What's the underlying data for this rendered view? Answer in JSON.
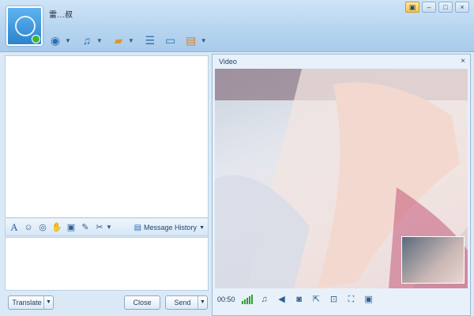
{
  "header": {
    "contact_name": "雷…叔"
  },
  "toolbar": {
    "icons": [
      "camera-icon",
      "microphone-icon",
      "folder-icon",
      "share-icon",
      "screen-icon",
      "app-icon"
    ]
  },
  "format_bar": {
    "icons": [
      "font-icon",
      "emoticon-icon",
      "circle-icon",
      "hand-icon",
      "image-icon",
      "edit-icon",
      "scissors-icon"
    ],
    "message_history_label": "Message History"
  },
  "bottom_bar": {
    "translate_label": "Translate",
    "close_label": "Close",
    "send_label": "Send"
  },
  "video": {
    "title": "Video",
    "close_glyph": "×",
    "timer": "00:50",
    "control_icons": [
      "signal-icon",
      "microphone-icon",
      "speaker-icon",
      "snapshot-icon",
      "popout-icon",
      "fit-icon",
      "fullscreen-icon",
      "window-icon"
    ]
  },
  "colors": {
    "window_bg": "#dbe9f6",
    "header_gradient_top": "#cfe4f7",
    "accent_blue": "#2c6eb3",
    "status_green": "#3cb43c"
  }
}
